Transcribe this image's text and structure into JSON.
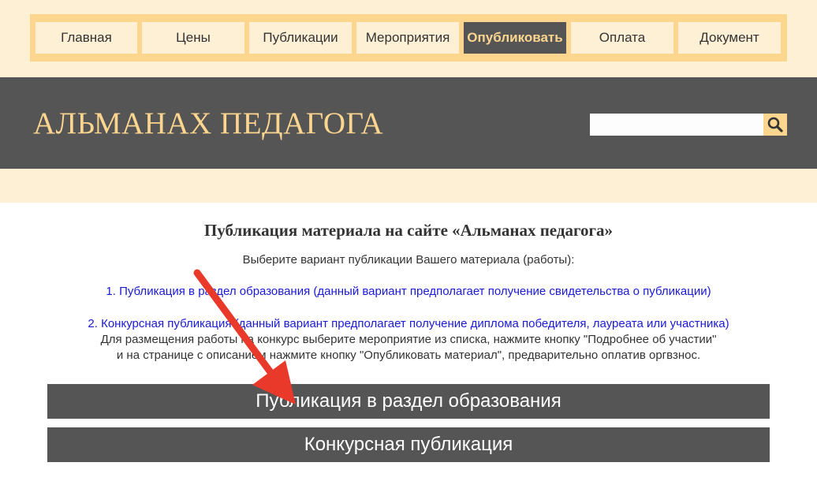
{
  "nav": {
    "items": [
      {
        "label": "Главная"
      },
      {
        "label": "Цены"
      },
      {
        "label": "Публикации"
      },
      {
        "label": "Мероприятия"
      },
      {
        "label": "Опубликовать",
        "active": true
      },
      {
        "label": "Оплата"
      },
      {
        "label": "Документ"
      }
    ]
  },
  "header": {
    "site_title": "АЛЬМАНАХ ПЕДАГОГА",
    "search": {
      "value": "",
      "placeholder": ""
    }
  },
  "content": {
    "title": "Публикация материала на сайте «Альманах педагога»",
    "subtitle": "Выберите вариант публикации Вашего материала (работы):",
    "option1": "1. Публикация в раздел образования (данный вариант предполагает получение свидетельства о публикации)",
    "option2": "2. Конкурсная публикация (данный вариант предполагает получение диплома победителя, лауреата или участника)",
    "note_line1": "Для размещения работы на конкурс выберите мероприятие из списка, нажмите кнопку \"Подробнее об участии\"",
    "note_line2": "и на странице с описанием нажмите кнопку \"Опубликовать материал\", предварительно оплатив оргвзнос."
  },
  "buttons": {
    "education": "Публикация в раздел образования",
    "contest": "Конкурсная публикация"
  },
  "colors": {
    "accent": "#fcd58f",
    "dark": "#555555",
    "light_band": "#fef0d5",
    "link_blue": "#1a1ad6",
    "arrow_red": "#e8392a"
  }
}
